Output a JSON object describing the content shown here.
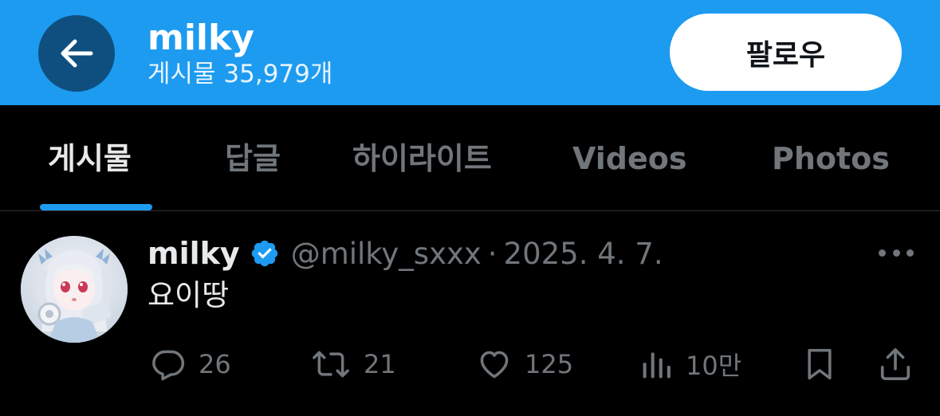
{
  "header": {
    "back_icon": "arrow-left-icon",
    "name": "milky",
    "posts_count": "게시물 35,979개",
    "follow_label": "팔로우"
  },
  "tabs": [
    {
      "label": "게시물",
      "active": true
    },
    {
      "label": "답글",
      "active": false
    },
    {
      "label": "하이라이트",
      "active": false
    },
    {
      "label": "Videos",
      "active": false
    },
    {
      "label": "Photos",
      "active": false
    }
  ],
  "post": {
    "author_name": "milky",
    "verified": true,
    "handle": "@milky_sxxx",
    "separator": "·",
    "date": "2025. 4. 7.",
    "text": "요이땅",
    "avatar": "avatar-image",
    "actions": {
      "replies": {
        "icon": "reply-icon",
        "count": "26"
      },
      "reposts": {
        "icon": "repost-icon",
        "count": "21"
      },
      "likes": {
        "icon": "heart-icon",
        "count": "125"
      },
      "views": {
        "icon": "analytics-icon",
        "count": "10만"
      },
      "bookmark": {
        "icon": "bookmark-icon"
      },
      "share": {
        "icon": "share-icon"
      }
    }
  },
  "colors": {
    "accent": "#1d9bf0",
    "back_button": "#0f4f7f",
    "background": "#000000",
    "text_primary": "#e7e9ea",
    "text_secondary": "#71767b"
  }
}
